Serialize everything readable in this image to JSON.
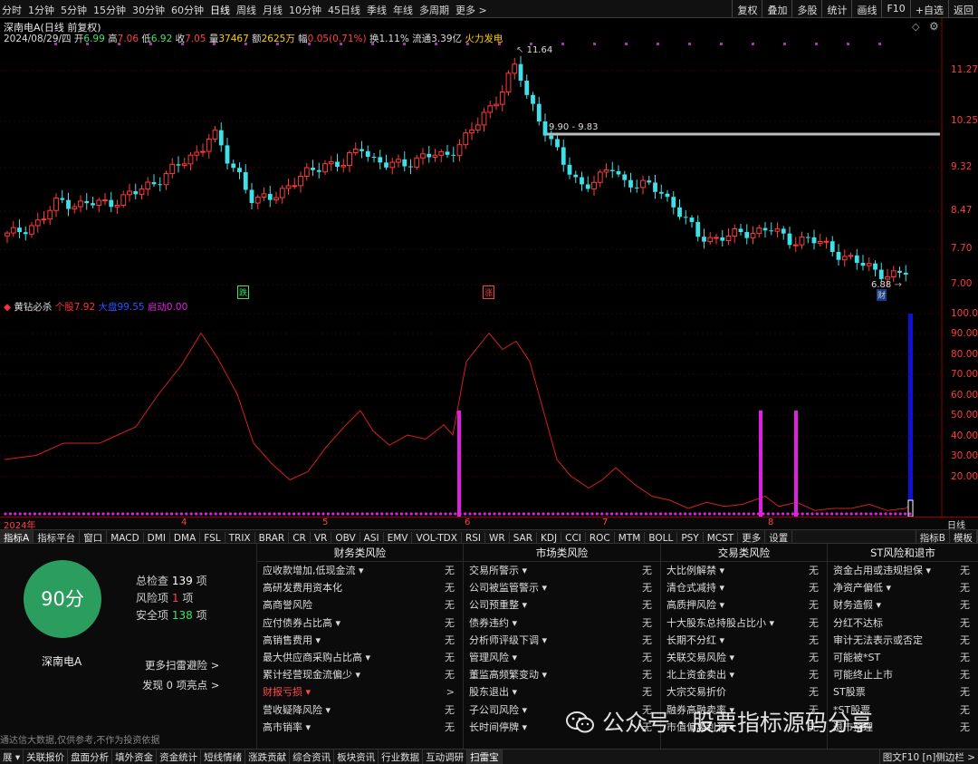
{
  "toolbar": {
    "periods": [
      "分时",
      "1分钟",
      "5分钟",
      "15分钟",
      "30分钟",
      "60分钟",
      "日线",
      "周线",
      "月线",
      "10分钟",
      "45日线",
      "季线",
      "年线",
      "多周期",
      "更多 >"
    ],
    "active_period": "日线",
    "right_tools": [
      "复权",
      "叠加",
      "多股",
      "统计",
      "画线",
      "F10",
      "+自选",
      "返回"
    ]
  },
  "quote": {
    "title": "深南电A(日线 前复权)",
    "date": "2024/08/29/四",
    "open_label": "开",
    "open": "6.99",
    "high_label": "高",
    "high": "7.06",
    "low_label": "低",
    "low": "6.92",
    "close_label": "收",
    "close": "7.05",
    "vol_label": "量",
    "vol": "37467",
    "amt_label": "额",
    "amt": "2625万",
    "chg_label": "幅",
    "chg": "0.05(0.71%)",
    "turnover": "换1.11%",
    "float_cap": "流通3.39亿",
    "concept": "火力发电"
  },
  "price_axis": [
    "11.27",
    "10.25",
    "9.32",
    "8.47",
    "7.70",
    "7.00"
  ],
  "annotations": {
    "peak": "11.64",
    "range": "9.90 - 9.83",
    "low": "6.88",
    "fin": "财",
    "die": "跌",
    "zhang": "涨"
  },
  "indicator": {
    "name": "黄钻必杀",
    "gegu_label": "个股",
    "gegu": "7.92",
    "dapan_label": "大盘",
    "dapan": "99.55",
    "qidong_label": "启动",
    "qidong": "0.00",
    "axis": [
      "100.0",
      "90.00",
      "80.00",
      "70.00",
      "60.00",
      "50.00",
      "40.00",
      "30.00",
      "20.00"
    ]
  },
  "time_axis": {
    "year": "2024年",
    "months": [
      "4",
      "5",
      "6",
      "7",
      "8"
    ],
    "period": "日线"
  },
  "tabs": [
    "指标A",
    "指标平台",
    "窗口",
    "MACD",
    "DMI",
    "DMA",
    "FSL",
    "TRIX",
    "BRAR",
    "CR",
    "VR",
    "OBV",
    "ASI",
    "EMV",
    "VOL-TDX",
    "RSI",
    "WR",
    "SAR",
    "KDJ",
    "CCI",
    "ROC",
    "MTM",
    "BOLL",
    "PSY",
    "MCST",
    "更多",
    "设置"
  ],
  "tabs_right": [
    "指标B",
    "模板"
  ],
  "colors": {
    "up": "#ff3b3b",
    "down": "#3fe0e8",
    "grid": "#3a0000",
    "indicator_line": "#d42020",
    "magenta": "#e020e0",
    "blue": "#1010d0"
  },
  "risk": {
    "score": "90分",
    "stock": "深南电A",
    "total_label": "总检查",
    "total": "139",
    "total_unit": "项",
    "risk_label": "风险项",
    "risk": "1",
    "risk_unit": "项",
    "safe_label": "安全项",
    "safe": "138",
    "safe_unit": "项",
    "more_link": "更多扫雷避险 >",
    "find_label": "发现",
    "find_count": "0",
    "find_unit": "项亮点 >",
    "disclaimer": "通达信大数据,仅供参考,不作为投资依据",
    "columns": [
      {
        "title": "财务类风险",
        "items": [
          {
            "label": "应收款增加,低现金流 ▾",
            "value": "无"
          },
          {
            "label": "高研发费用资本化",
            "value": "无"
          },
          {
            "label": "高商誉风险",
            "value": "无"
          },
          {
            "label": "应付债券占比高 ▾",
            "value": "无"
          },
          {
            "label": "高销售费用 ▾",
            "value": "无"
          },
          {
            "label": "最大供应商采购占比高 ▾",
            "value": "无"
          },
          {
            "label": "累计经营现金流偏少 ▾",
            "value": "无"
          },
          {
            "label": "财报亏损 ▾",
            "value": ">",
            "alert": true
          },
          {
            "label": "营收疑降风险 ▾",
            "value": "无"
          },
          {
            "label": "高市销率 ▾",
            "value": "无"
          }
        ]
      },
      {
        "title": "市场类风险",
        "items": [
          {
            "label": "交易所警示 ▾",
            "value": "无"
          },
          {
            "label": "公司被监管警示 ▾",
            "value": "无"
          },
          {
            "label": "公司预重整 ▾",
            "value": "无"
          },
          {
            "label": "债券违约 ▾",
            "value": "无"
          },
          {
            "label": "分析师评级下调 ▾",
            "value": "无"
          },
          {
            "label": "管理风险 ▾",
            "value": "无"
          },
          {
            "label": "董监高频繁变动 ▾",
            "value": "无"
          },
          {
            "label": "股东退出 ▾",
            "value": "无"
          },
          {
            "label": "子公司风险 ▾",
            "value": "无"
          },
          {
            "label": "长时间停牌 ▾",
            "value": "无"
          }
        ]
      },
      {
        "title": "交易类风险",
        "items": [
          {
            "label": "大比例解禁 ▾",
            "value": "无"
          },
          {
            "label": "清仓式减持 ▾",
            "value": "无"
          },
          {
            "label": "高质押风险 ▾",
            "value": "无"
          },
          {
            "label": "十大股东总持股占比小 ▾",
            "value": "无"
          },
          {
            "label": "长期不分红 ▾",
            "value": "无"
          },
          {
            "label": "关联交易风险 ▾",
            "value": "无"
          },
          {
            "label": "北上资金卖出 ▾",
            "value": "无"
          },
          {
            "label": "大宗交易折价",
            "value": "无"
          },
          {
            "label": "融券高融卖率 ▾",
            "value": "无"
          },
          {
            "label": "市值偏离利润 ▾",
            "value": "无"
          }
        ]
      },
      {
        "title": "ST风险和退市",
        "items": [
          {
            "label": "资金占用或违规担保 ▾",
            "value": "无"
          },
          {
            "label": "净资产偏低 ▾",
            "value": "无"
          },
          {
            "label": "财务造假 ▾",
            "value": "无"
          },
          {
            "label": "分红不达标",
            "value": "无"
          },
          {
            "label": "审计无法表示或否定",
            "value": "无"
          },
          {
            "label": "可能被*ST",
            "value": "无"
          },
          {
            "label": "可能终止上市",
            "value": "无"
          },
          {
            "label": "ST股票",
            "value": "无"
          },
          {
            "label": "*ST股票",
            "value": "无"
          },
          {
            "label": "退市整理",
            "value": "无"
          }
        ]
      }
    ]
  },
  "bottom_bar": [
    "展 ▾",
    "关联报价",
    "盘面分析",
    "填外资金",
    "资金统计",
    "短线情绪",
    "涨跌贡献",
    "综合资讯",
    "板块资讯",
    "行业数据",
    "互动调研",
    "扫雷宝"
  ],
  "bottom_active": "扫雷宝",
  "bottom_right": "图文F10 [n]侧边栏 >",
  "watermark": "公众号 · 股票指标源码分享"
}
